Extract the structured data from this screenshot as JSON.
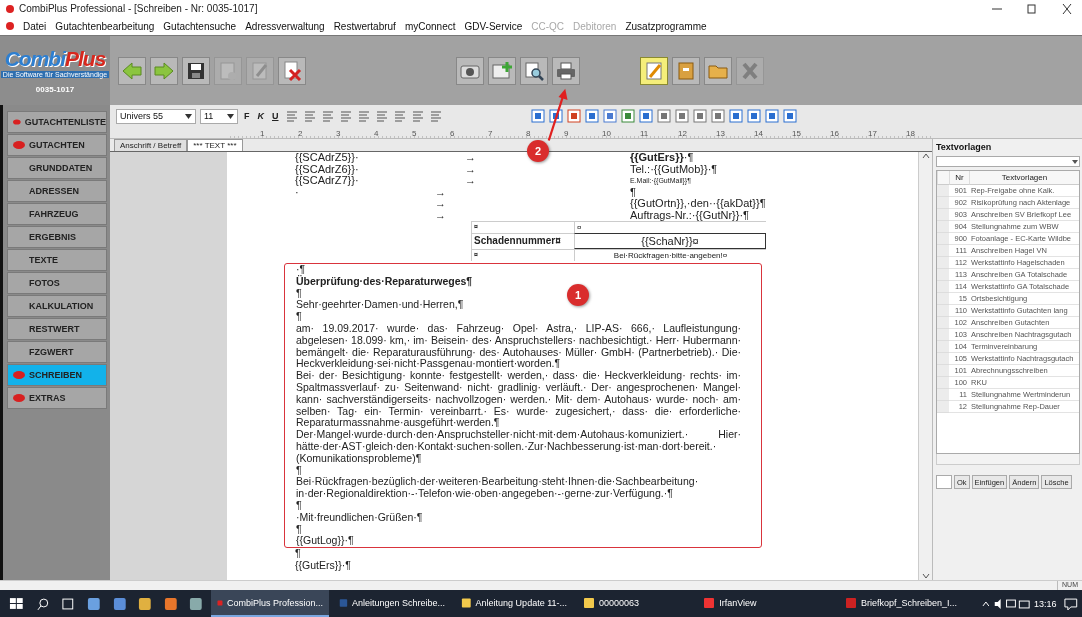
{
  "window": {
    "title": "CombiPlus Professional - [Schreiben - Nr: 0035-1017]"
  },
  "menu": [
    {
      "label": "Datei",
      "disabled": false
    },
    {
      "label": "Gutachtenbearbeitung",
      "disabled": false
    },
    {
      "label": "Gutachtensuche",
      "disabled": false
    },
    {
      "label": "Adressverwaltung",
      "disabled": false
    },
    {
      "label": "Restwertabruf",
      "disabled": false
    },
    {
      "label": "myConnect",
      "disabled": false
    },
    {
      "label": "GDV-Service",
      "disabled": false
    },
    {
      "label": "CC-QC",
      "disabled": true
    },
    {
      "label": "Debitoren",
      "disabled": true
    },
    {
      "label": "Zusatzprogramme",
      "disabled": false
    }
  ],
  "logo": {
    "brand_first": "Combi",
    "brand_second": "Plus",
    "tagline": "Die Software für Sachverständige",
    "number": "0035-1017"
  },
  "toolbar_groups": [
    [
      {
        "kind": "back",
        "disabled": false,
        "highlighted": false
      },
      {
        "kind": "forward",
        "disabled": false,
        "highlighted": false
      },
      {
        "kind": "save",
        "disabled": false,
        "highlighted": false
      },
      {
        "kind": "stamp",
        "disabled": true,
        "highlighted": false
      },
      {
        "kind": "edit",
        "disabled": true,
        "highlighted": false
      },
      {
        "kind": "delete",
        "disabled": false,
        "highlighted": false
      }
    ],
    [
      {
        "kind": "camera",
        "disabled": false,
        "highlighted": false
      },
      {
        "kind": "add",
        "disabled": false,
        "highlighted": false
      },
      {
        "kind": "preview",
        "disabled": false,
        "highlighted": false
      },
      {
        "kind": "print",
        "disabled": false,
        "highlighted": false
      }
    ],
    [
      {
        "kind": "note",
        "disabled": false,
        "highlighted": true
      },
      {
        "kind": "cabinet",
        "disabled": false,
        "highlighted": false
      },
      {
        "kind": "folder",
        "disabled": false,
        "highlighted": false
      },
      {
        "kind": "close",
        "disabled": true,
        "highlighted": false
      }
    ]
  ],
  "format_bar": {
    "font": "Univers 55",
    "size": "11",
    "styles": [
      {
        "label": "F",
        "kind": "bold"
      },
      {
        "label": "K",
        "kind": "italic"
      },
      {
        "label": "U",
        "kind": "underline"
      }
    ]
  },
  "ruler": {
    "marks": [
      "1",
      "2",
      "3",
      "4",
      "5",
      "6",
      "7",
      "8",
      "9",
      "10",
      "11",
      "12",
      "13",
      "14",
      "15",
      "16",
      "17",
      "18"
    ]
  },
  "tabs": [
    {
      "label": "Anschrift / Betreff",
      "selected": false
    },
    {
      "label": "*** TEXT ***",
      "selected": true
    }
  ],
  "sidebar": [
    {
      "label": "GUTACHTENLISTE",
      "marked": true,
      "selected": false
    },
    {
      "label": "GUTACHTEN",
      "marked": true,
      "selected": false
    },
    {
      "label": "GRUNDDATEN",
      "marked": false,
      "selected": false
    },
    {
      "label": "ADRESSEN",
      "marked": false,
      "selected": false
    },
    {
      "label": "FAHRZEUG",
      "marked": false,
      "selected": false
    },
    {
      "label": "ERGEBNIS",
      "marked": false,
      "selected": false
    },
    {
      "label": "TEXTE",
      "marked": false,
      "selected": false
    },
    {
      "label": "FOTOS",
      "marked": false,
      "selected": false
    },
    {
      "label": "KALKULATION",
      "marked": false,
      "selected": false
    },
    {
      "label": "RESTWERT",
      "marked": false,
      "selected": false
    },
    {
      "label": "FZGWERT",
      "marked": false,
      "selected": false
    },
    {
      "label": "SCHREIBEN",
      "marked": true,
      "selected": true
    },
    {
      "label": "EXTRAS",
      "marked": true,
      "selected": false
    }
  ],
  "document": {
    "address_lines": [
      {
        "kind": "field",
        "left": "{{SCAdrZ5}}·",
        "arrow": "→",
        "right": "**{{GutErs}}**·¶"
      },
      {
        "kind": "field",
        "left": "{{SCAdrZ6}}·",
        "arrow": "→",
        "right": "Tel.:·{{GutMob}}·¶"
      },
      {
        "kind": "small",
        "left": "{{SCAdrZ7}}·",
        "arrow": "→",
        "right": "E.Mail:·{{GutMail}}¶"
      },
      {
        "kind": "tab",
        "left": "·",
        "arrow": "→",
        "right": "¶"
      },
      {
        "kind": "tab",
        "arrow": "→",
        "right": "{{GutOrtn}},·den··{{akDat}}¶"
      },
      {
        "kind": "tab",
        "arrow": "→",
        "right": "Auftrags-Nr.:·{{GutNr}}·¶"
      }
    ],
    "table": [
      {
        "label": "¤",
        "value": "¤",
        "kind": "plain"
      },
      {
        "label": "Schadennummer¤",
        "value": "{{SchaNr}}¤",
        "kind": "boxed"
      },
      {
        "label": "¤",
        "value": "Bei·Rückfragen·bitte·angeben!¤",
        "kind": "note"
      }
    ],
    "letter": [
      {
        "kind": "line",
        "text": "·¶"
      },
      {
        "kind": "heading",
        "text": "Überprüfung·des·Reparaturweges¶"
      },
      {
        "kind": "line",
        "text": "¶"
      },
      {
        "kind": "line",
        "text": "Sehr·geehrter·Damen·und·Herren,¶"
      },
      {
        "kind": "line",
        "text": "¶"
      },
      {
        "kind": "para",
        "text": "am· 19.09.2017· wurde· das· Fahrzeug· Opel· Astra,· LIP-AS· 666,· Laufleistungung· abgelesen· 18.099· km,· im· Beisein· des· Anspruchstellers· nachbesichtigt.· Herr· Hubermann· bemängelt· die· Reparaturausführung· des· Autohauses· Müller· GmbH· (Partnerbetrieb).· Die· Heckverkleidung·sei·nicht·Passgenau·montiert·worden.¶"
      },
      {
        "kind": "para",
        "text": "Bei· der· Besichtigung· konnte· festgestellt· werden,· dass· die· Heckverkleidung· rechts· im· Spaltmassverlauf· zu· Seitenwand· nicht· gradlinig· verläuft.· Der· angesprochenen· Mangel· kann· sachverständigerseits· nachvollzogen· werden.· Mit· dem· Autohaus· wurde· noch· am· selben· Tag· ein· Termin· vereinbarrt.· Es· wurde· zugesichert,· dass· die· erforderliche· Reparaturmassnahme·ausgeführt·werden.¶"
      },
      {
        "kind": "para",
        "text": "Der·Mangel·wurde·durch·den·Anspruchsteller·nicht·mit·dem·Autohaus·komuniziert.· Hier· hätte·der·AST·gleich·den·Kontakt·suchen·sollen.·Zur·Nachbesserung·ist·man·dort·bereit.· (Komunikationsprobleme)¶"
      },
      {
        "kind": "line",
        "text": "¶"
      },
      {
        "kind": "line",
        "text": "Bei·Rückfragen·bezüglich·der·weiteren·Bearbeitung·steht·Ihnen·die·Sachbearbeitung·"
      },
      {
        "kind": "line",
        "text": "in·der·Regionaldirektion·-·Telefon·wie·oben·angegeben·-·gerne·zur·Verfügung.·¶"
      },
      {
        "kind": "line",
        "text": "¶"
      },
      {
        "kind": "line",
        "text": "·Mit·freundlichen·Grüßen·¶"
      },
      {
        "kind": "line",
        "text": "¶"
      },
      {
        "kind": "line",
        "text": "{{GutLog}}·¶"
      }
    ],
    "after": [
      {
        "kind": "line",
        "text": "¶"
      },
      {
        "kind": "line",
        "text": "{{GutErs}}·¶"
      }
    ]
  },
  "annotations": [
    {
      "label": "1"
    },
    {
      "label": "2"
    }
  ],
  "templates": {
    "title": "Textvorlagen",
    "columns": [
      "Nr",
      "Textvorlagen"
    ],
    "rows": [
      {
        "nr": "901",
        "name": "Rep-Freigabe ohne Kalk."
      },
      {
        "nr": "902",
        "name": "Risikoprüfung nach Aktenlage"
      },
      {
        "nr": "903",
        "name": "Anschreiben SV Briefkopf Lee"
      },
      {
        "nr": "904",
        "name": "Stellungnahme zum WBW"
      },
      {
        "nr": "900",
        "name": "Fotoanlage - EC-Karte Wildbe"
      },
      {
        "nr": "111",
        "name": "Anschreiben Hagel VN"
      },
      {
        "nr": "112",
        "name": "Werkstattinfo Hagelschaden"
      },
      {
        "nr": "113",
        "name": "Anschreiben GA Totalschade"
      },
      {
        "nr": "114",
        "name": "Werkstattinfo GA Totalschade"
      },
      {
        "nr": "15",
        "name": "Ortsbesichtigung"
      },
      {
        "nr": "110",
        "name": "Werkstattinfo Gutachten lang"
      },
      {
        "nr": "102",
        "name": "Anschreiben Gutachten"
      },
      {
        "nr": "103",
        "name": "Anschreiben Nachtragsgutach"
      },
      {
        "nr": "104",
        "name": "Terminvereinbarung"
      },
      {
        "nr": "105",
        "name": "Werkstattinfo Nachtragsgutach"
      },
      {
        "nr": "101",
        "name": "Abrechnungsschreiben"
      },
      {
        "nr": "100",
        "name": "RKU"
      },
      {
        "nr": "11",
        "name": "Stellungnahme Wertminderun"
      },
      {
        "nr": "12",
        "name": "Stellungnahme Rep-Dauer"
      }
    ],
    "buttons": [
      "Ok",
      "Einfügen",
      "Ändern",
      "Lösche"
    ]
  },
  "status_bar": {
    "indicator": "NUM"
  },
  "taskbar": {
    "apps": [
      {
        "label": "CombiPlus Profession...",
        "kind": "app",
        "active": true
      },
      {
        "label": "Anleitungen Schreibe...",
        "kind": "word",
        "active": false
      },
      {
        "label": "Anleitung Update 11-...",
        "kind": "folder",
        "active": false
      },
      {
        "label": "00000063",
        "kind": "folder",
        "active": false
      },
      {
        "label": "IrfanView",
        "kind": "viewer",
        "active": false
      },
      {
        "label": "Briefkopf_Schreiben_I...",
        "kind": "pdf",
        "active": false
      }
    ],
    "clock": "13:16"
  }
}
